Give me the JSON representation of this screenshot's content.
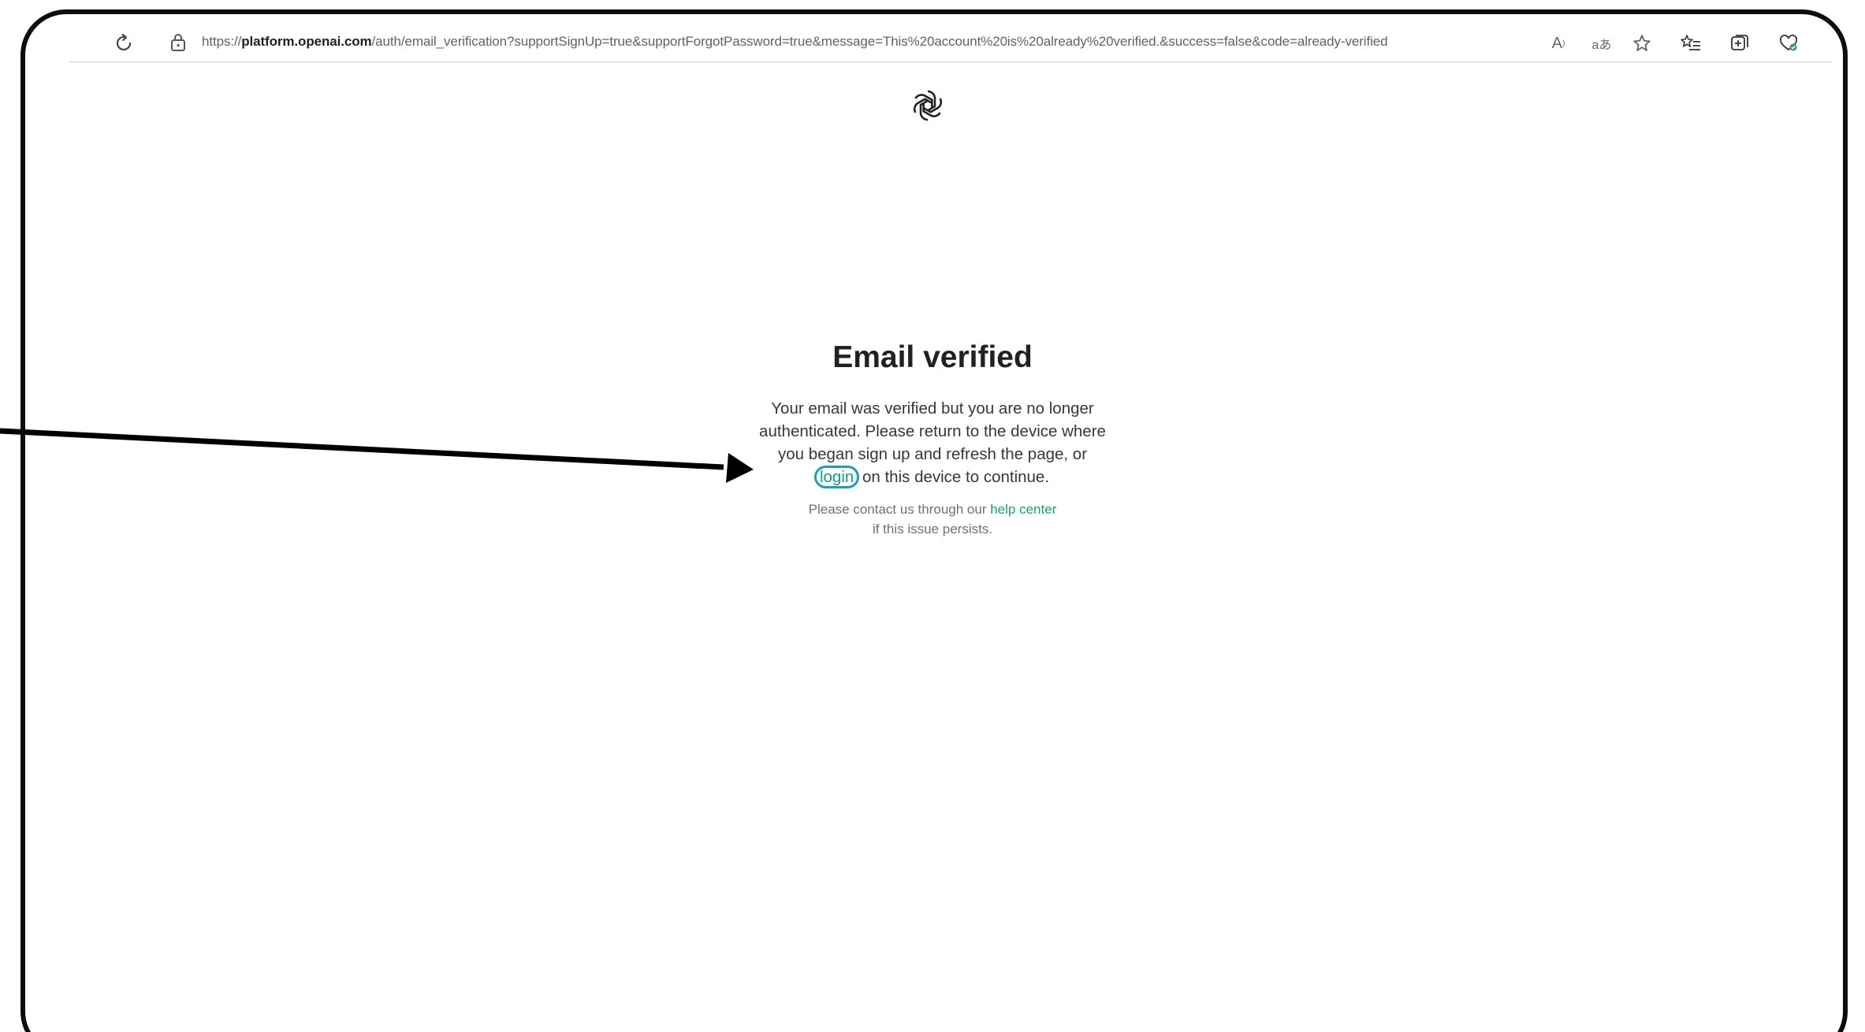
{
  "browser": {
    "url_prefix": "https://",
    "url_host": "platform.openai.com",
    "url_rest": "/auth/email_verification?supportSignUp=true&supportForgotPassword=true&message=This%20account%20is%20already%20verified.&success=false&code=already-verified",
    "icons": {
      "reload": "reload-icon",
      "lock": "site-info-lock-icon",
      "read_aloud": "read-aloud-icon",
      "translate": "translate-icon",
      "favorite": "star-icon",
      "favorites_list": "favorites-icon",
      "collections": "collections-icon",
      "extension": "extension-icon"
    },
    "read_aloud_label": "A",
    "translate_label": "aあ"
  },
  "page": {
    "logo": "openai-logo-icon",
    "title": "Email verified",
    "message_before": "Your email was verified but you are no longer authenticated. Please return to the device where you began sign up and refresh the page, or ",
    "login_link": "login",
    "message_after": " on this device to continue.",
    "contact_before": "Please contact us through our ",
    "help_link": "help center",
    "contact_after": " if this issue persists."
  },
  "colors": {
    "frame": "#0d0d0d",
    "link": "#10a37f",
    "highlight_circle": "#17a2b8",
    "arrow": "#000000"
  }
}
